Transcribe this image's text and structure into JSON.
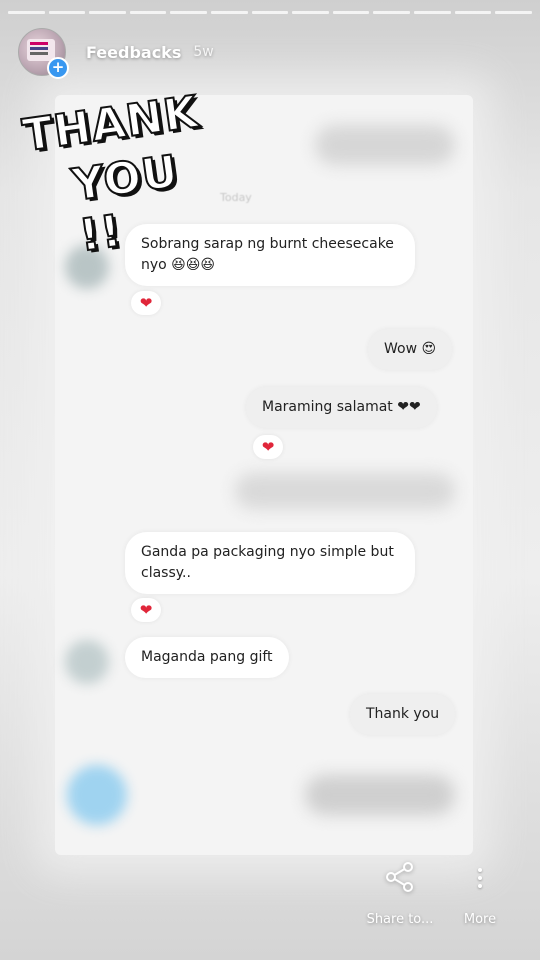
{
  "story": {
    "username": "Feedbacks",
    "time_ago": "5w",
    "progress_segments": 13,
    "active_segment": 0
  },
  "sticker": {
    "line1": "THANK",
    "line2": "YOU !!"
  },
  "chat": {
    "date_divider": "Today",
    "messages": [
      {
        "direction": "in",
        "text": "Sobrang sarap ng burnt cheesecake nyo 😆😆😆",
        "reaction": "❤"
      },
      {
        "direction": "out",
        "text": "Wow 😍"
      },
      {
        "direction": "out",
        "text": "Maraming salamat ❤❤",
        "reaction": "❤"
      },
      {
        "direction": "in",
        "text": "Ganda pa packaging nyo simple but classy..",
        "reaction": "❤"
      },
      {
        "direction": "in",
        "text": "Maganda pang gift"
      },
      {
        "direction": "out",
        "text": "Thank you"
      }
    ]
  },
  "actions": {
    "share_label": "Share to...",
    "more_label": "More"
  },
  "colors": {
    "heart": "#e0263a",
    "add_badge": "#3897f0"
  }
}
